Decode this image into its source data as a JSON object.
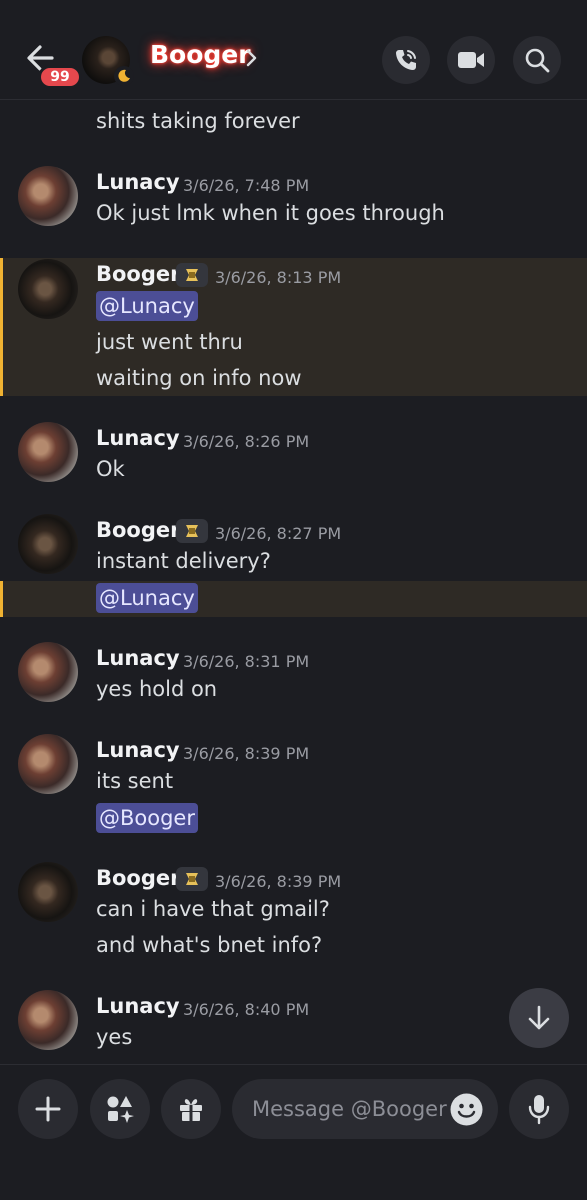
{
  "header": {
    "unread_count": "99",
    "name": "Booger",
    "chevron": "›"
  },
  "messages": {
    "m0": {
      "text": "shits taking forever"
    },
    "m1": {
      "author": "Lunacy",
      "time": "3/6/26, 7:48 PM",
      "text": "Ok just lmk when it goes through"
    },
    "m2": {
      "author": "Booger",
      "time": "3/6/26, 8:13 PM",
      "mention": "@Lunacy",
      "line1": "just went thru",
      "line2": "waiting on info now"
    },
    "m3": {
      "author": "Lunacy",
      "time": "3/6/26, 8:26 PM",
      "text": "Ok"
    },
    "m4": {
      "author": "Booger",
      "time": "3/6/26, 8:27 PM",
      "text": "instant delivery?",
      "mention": "@Lunacy"
    },
    "m5": {
      "author": "Lunacy",
      "time": "3/6/26, 8:31 PM",
      "text": "yes hold on"
    },
    "m6": {
      "author": "Lunacy",
      "time": "3/6/26, 8:39 PM",
      "text": "its sent",
      "mention": "@Booger"
    },
    "m7": {
      "author": "Booger",
      "time": "3/6/26, 8:39 PM",
      "line1": "can i have that gmail?",
      "line2": "and what's bnet info?"
    },
    "m8": {
      "author": "Lunacy",
      "time": "3/6/26, 8:40 PM",
      "text": "yes"
    }
  },
  "composer": {
    "placeholder": "Message @Booger"
  },
  "icons": {
    "back": "arrow-left-icon",
    "call": "phone-call-icon",
    "video": "video-camera-icon",
    "search": "search-icon",
    "add": "plus-icon",
    "apps": "apps-sparkle-icon",
    "gift": "gift-icon",
    "emoji": "emoji-icon",
    "mic": "microphone-icon",
    "scroll": "arrow-down-icon",
    "tag": "server-tag-icon"
  },
  "colors": {
    "background": "#1c1d22",
    "mention_bg": "#4c4e96",
    "highlight_bg": "#2e2a25",
    "highlight_bar": "#f0b232",
    "badge": "#e5484d",
    "name_glow": "#ff3b30"
  }
}
